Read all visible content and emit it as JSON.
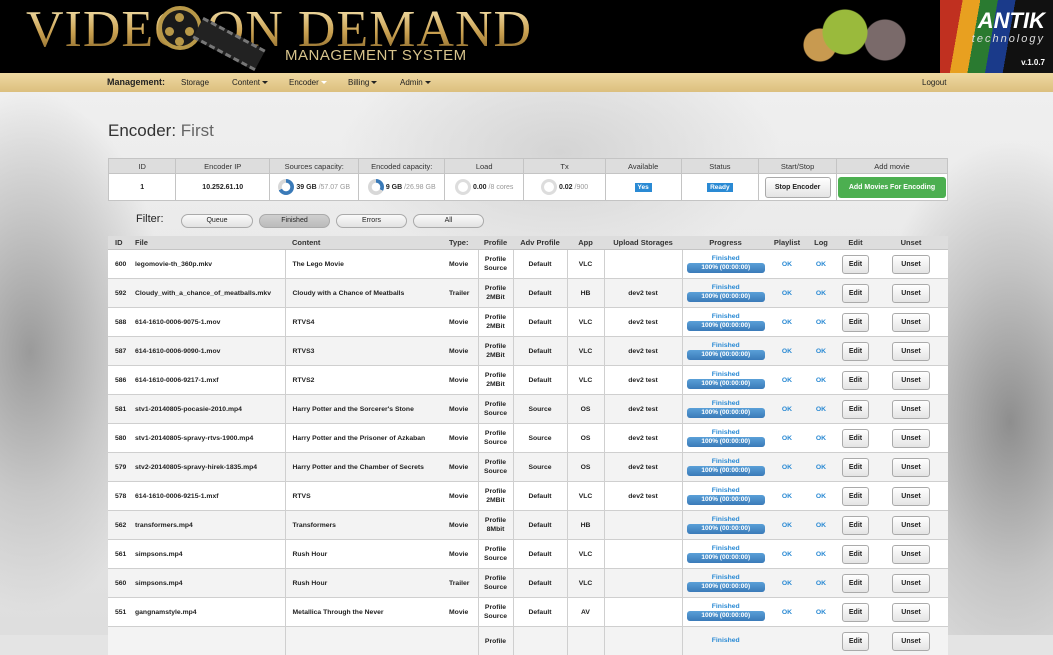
{
  "header": {
    "logo_title": "VIDEO ON DEMAND",
    "logo_subtitle": "MANAGEMENT SYSTEM",
    "brand": "ANTIK",
    "brand_sub": "technology",
    "version": "v.1.0.7"
  },
  "nav": {
    "label": "Management:",
    "items": [
      {
        "label": "Storage",
        "dropdown": false
      },
      {
        "label": "Content",
        "dropdown": true
      },
      {
        "label": "Encoder",
        "dropdown": true,
        "active": true
      },
      {
        "label": "Billing",
        "dropdown": true
      },
      {
        "label": "Admin",
        "dropdown": true
      }
    ],
    "logout": "Logout"
  },
  "page": {
    "title_prefix": "Encoder:",
    "title_name": "First"
  },
  "summary": {
    "headers": [
      "ID",
      "Encoder IP",
      "Sources capacity:",
      "Encoded capacity:",
      "Load",
      "Tx",
      "Available",
      "Status",
      "Start/Stop",
      "Add movie"
    ],
    "id": "1",
    "ip": "10.252.61.10",
    "sources_used": "39 GB",
    "sources_total": "/57.07 GB",
    "sources_fraction": 0.68,
    "encoded_used": "9 GB",
    "encoded_total": "/26.98 GB",
    "encoded_fraction": 0.33,
    "load_value": "0.00",
    "load_total": "/8 cores",
    "tx_value": "0.02",
    "tx_total": "/900",
    "available": "Yes",
    "status": "Ready",
    "stop_button": "Stop Encoder",
    "add_button": "Add Movies For Encoding"
  },
  "filter": {
    "label": "Filter:",
    "buttons": [
      "Queue",
      "Finished",
      "Errors",
      "All"
    ],
    "active": "Finished"
  },
  "table": {
    "headers": [
      "ID",
      "File",
      "Content",
      "Type:",
      "Profile",
      "Adv Profile",
      "App",
      "Upload Storages",
      "Progress",
      "Playlist",
      "Log",
      "Edit",
      "Unset"
    ],
    "status_text": "Finished",
    "progress_text": "100% (00:00:00)",
    "progress_fraction": 1.0,
    "ok_text": "OK",
    "edit_label": "Edit",
    "unset_label": "Unset",
    "rows": [
      {
        "id": "600",
        "file": "legomovie-th_360p.mkv",
        "content": "The Lego Movie",
        "type": "Movie",
        "p1": "Profile",
        "p2": "Source",
        "adv": "Default",
        "app": "VLC",
        "storage": ""
      },
      {
        "id": "592",
        "file": "Cloudy_with_a_chance_of_meatballs.mkv",
        "content": "Cloudy with a Chance of Meatballs",
        "type": "Trailer",
        "p1": "Profile",
        "p2": "2MBit",
        "adv": "Default",
        "app": "HB",
        "storage": "dev2 test"
      },
      {
        "id": "588",
        "file": "614-1610-0006-9075-1.mov",
        "content": "RTVS4",
        "type": "Movie",
        "p1": "Profile",
        "p2": "2MBit",
        "adv": "Default",
        "app": "VLC",
        "storage": "dev2 test"
      },
      {
        "id": "587",
        "file": "614-1610-0006-9090-1.mov",
        "content": "RTVS3",
        "type": "Movie",
        "p1": "Profile",
        "p2": "2MBit",
        "adv": "Default",
        "app": "VLC",
        "storage": "dev2 test"
      },
      {
        "id": "586",
        "file": "614-1610-0006-9217-1.mxf",
        "content": "RTVS2",
        "type": "Movie",
        "p1": "Profile",
        "p2": "2MBit",
        "adv": "Default",
        "app": "VLC",
        "storage": "dev2 test"
      },
      {
        "id": "581",
        "file": "stv1-20140805-pocasie-2010.mp4",
        "content": "Harry Potter and the Sorcerer's Stone",
        "type": "Movie",
        "p1": "Profile",
        "p2": "Source",
        "adv": "Source",
        "app": "OS",
        "storage": "dev2 test"
      },
      {
        "id": "580",
        "file": "stv1-20140805-spravy-rtvs-1900.mp4",
        "content": "Harry Potter and the Prisoner of Azkaban",
        "type": "Movie",
        "p1": "Profile",
        "p2": "Source",
        "adv": "Source",
        "app": "OS",
        "storage": "dev2 test"
      },
      {
        "id": "579",
        "file": "stv2-20140805-spravy-hirek-1835.mp4",
        "content": "Harry Potter and the Chamber of Secrets",
        "type": "Movie",
        "p1": "Profile",
        "p2": "Source",
        "adv": "Source",
        "app": "OS",
        "storage": "dev2 test"
      },
      {
        "id": "578",
        "file": "614-1610-0006-9215-1.mxf",
        "content": "RTVS",
        "type": "Movie",
        "p1": "Profile",
        "p2": "2MBit",
        "adv": "Default",
        "app": "VLC",
        "storage": "dev2 test"
      },
      {
        "id": "562",
        "file": "transformers.mp4",
        "content": "Transformers",
        "type": "Movie",
        "p1": "Profile",
        "p2": "8Mbit",
        "adv": "Default",
        "app": "HB",
        "storage": ""
      },
      {
        "id": "561",
        "file": "simpsons.mp4",
        "content": "Rush Hour",
        "type": "Movie",
        "p1": "Profile",
        "p2": "Source",
        "adv": "Default",
        "app": "VLC",
        "storage": ""
      },
      {
        "id": "560",
        "file": "simpsons.mp4",
        "content": "Rush Hour",
        "type": "Trailer",
        "p1": "Profile",
        "p2": "Source",
        "adv": "Default",
        "app": "VLC",
        "storage": ""
      },
      {
        "id": "551",
        "file": "gangnamstyle.mp4",
        "content": "Metallica Through the Never",
        "type": "Movie",
        "p1": "Profile",
        "p2": "Source",
        "adv": "Default",
        "app": "AV",
        "storage": ""
      },
      {
        "id": "",
        "file": "",
        "content": "",
        "type": "",
        "p1": "Profile",
        "p2": "",
        "adv": "",
        "app": "",
        "storage": ""
      }
    ]
  }
}
